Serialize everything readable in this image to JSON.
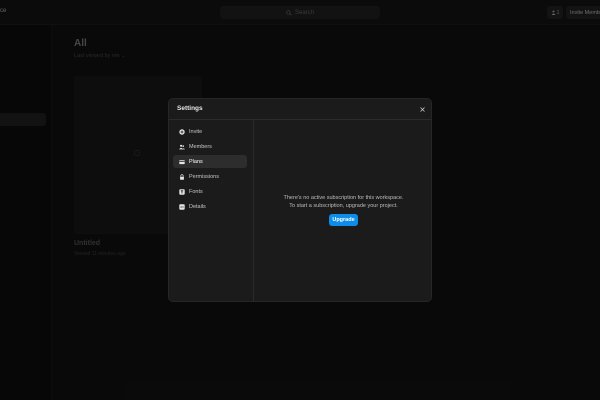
{
  "topbar": {
    "workspace_name": "ce",
    "search_placeholder": "Search",
    "user_count": "1",
    "invite_label": "Invite Members"
  },
  "main": {
    "title": "All",
    "sort_label": "Last viewed by me",
    "card": {
      "title": "Untitled",
      "meta": "Viewed 11 minutes ago"
    }
  },
  "modal": {
    "title": "Settings",
    "nav": [
      {
        "label": "Invite",
        "icon": "plus-circle-icon"
      },
      {
        "label": "Members",
        "icon": "users-icon"
      },
      {
        "label": "Plans",
        "icon": "card-icon",
        "active": true
      },
      {
        "label": "Permissions",
        "icon": "lock-icon"
      },
      {
        "label": "Fonts",
        "icon": "font-icon"
      },
      {
        "label": "Details",
        "icon": "details-icon"
      }
    ],
    "message_line1": "There's no active subscription for this workspace.",
    "message_line2": "To start a subscription, upgrade your project.",
    "upgrade_label": "Upgrade"
  },
  "colors": {
    "accent": "#0d8ce9",
    "modal_bg": "#1b1b1b",
    "page_bg": "#0a0a0a"
  }
}
